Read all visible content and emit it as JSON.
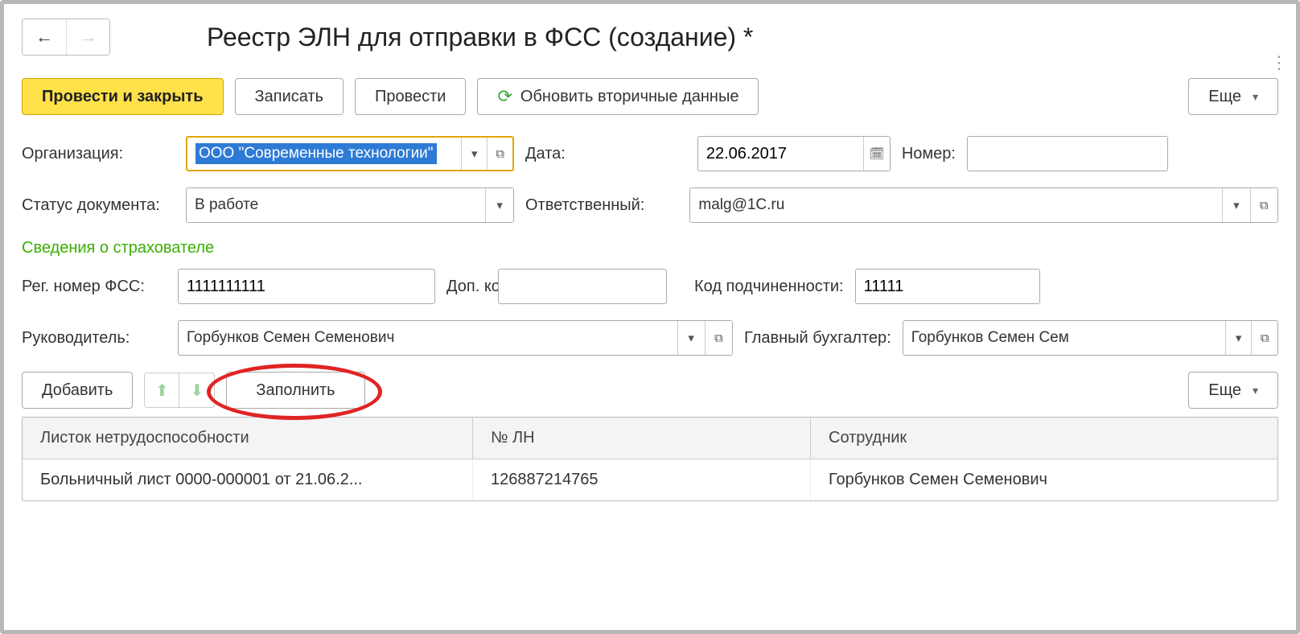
{
  "title": "Реестр ЭЛН для отправки в ФСС (создание) *",
  "toolbar": {
    "post_close": "Провести и закрыть",
    "save": "Записать",
    "post": "Провести",
    "refresh": "Обновить вторичные данные",
    "more": "Еще"
  },
  "labels": {
    "organization": "Организация:",
    "date": "Дата:",
    "number": "Номер:",
    "doc_status": "Статус документа:",
    "responsible": "Ответственный:",
    "section_insurer": "Сведения о страхователе",
    "reg_fss": "Рег. номер ФСС:",
    "add_code": "Доп. код:",
    "sub_code": "Код подчиненности:",
    "head": "Руководитель:",
    "chief_acc": "Главный бухгалтер:"
  },
  "fields": {
    "organization": "ООО \"Современные технологии\"",
    "date": "22.06.2017",
    "number": "",
    "doc_status": "В работе",
    "responsible": "malg@1C.ru",
    "reg_fss": "1111111111",
    "add_code": "",
    "sub_code": "11111",
    "head": "Горбунков Семен Семенович",
    "chief_acc": "Горбунков Семен Сем"
  },
  "table_toolbar": {
    "add": "Добавить",
    "fill": "Заполнить",
    "more": "Еще"
  },
  "table": {
    "columns": [
      "Листок нетрудоспособности",
      "№ ЛН",
      "Сотрудник"
    ],
    "rows": [
      {
        "doc": "Больничный лист 0000-000001 от 21.06.2...",
        "num": "126887214765",
        "emp": "Горбунков Семен Семенович"
      }
    ]
  }
}
